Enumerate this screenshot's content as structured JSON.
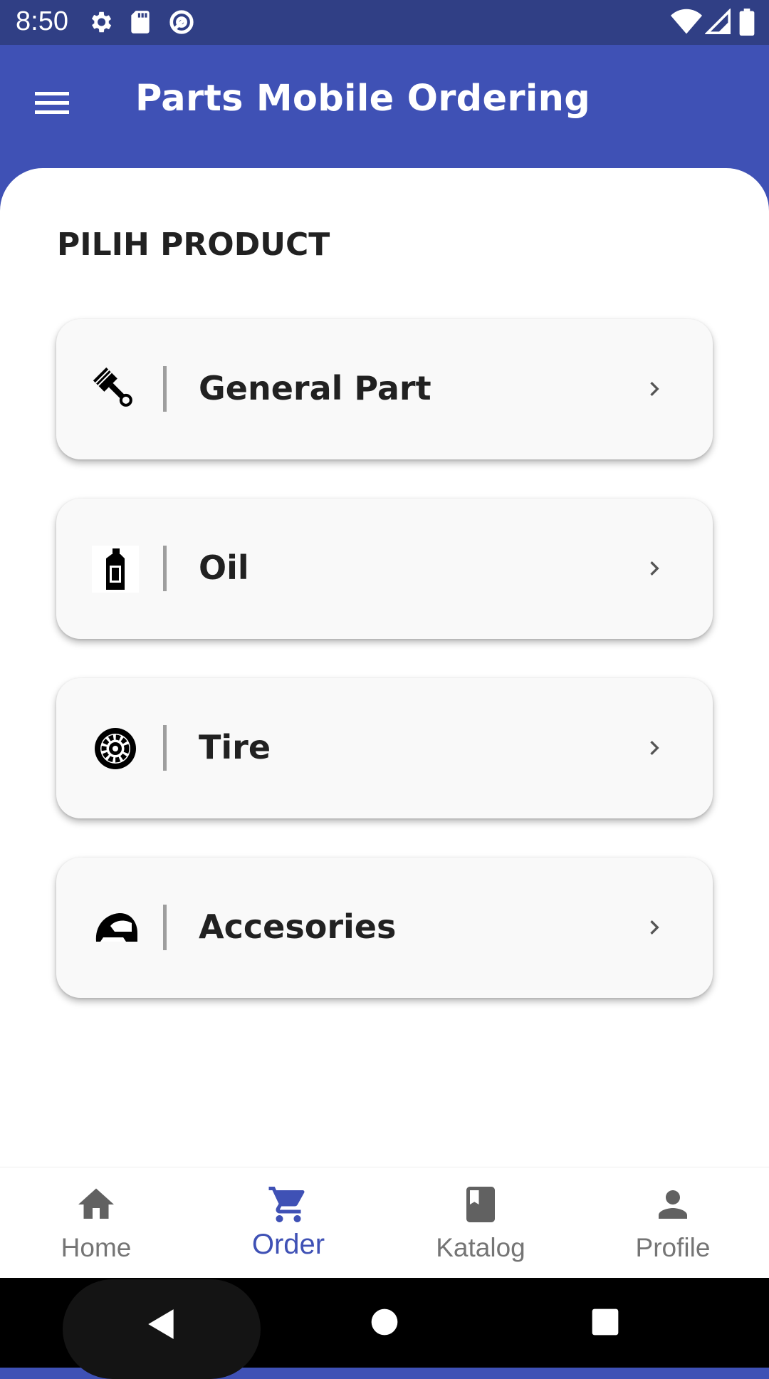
{
  "status_bar": {
    "time": "8:50",
    "icons": [
      "settings-icon",
      "sd-card-icon",
      "at-sign-icon",
      "wifi-icon",
      "signal-icon",
      "battery-icon"
    ]
  },
  "app_bar": {
    "title": "Parts Mobile Ordering",
    "menu_icon": "hamburger-menu-icon"
  },
  "section": {
    "title": "PILIH PRODUCT"
  },
  "products": [
    {
      "label": "General Part",
      "icon": "piston-icon"
    },
    {
      "label": "Oil",
      "icon": "oil-bottle-icon"
    },
    {
      "label": "Tire",
      "icon": "tire-icon"
    },
    {
      "label": "Accesories",
      "icon": "helmet-icon"
    }
  ],
  "bottom_nav": [
    {
      "label": "Home",
      "icon": "home-icon",
      "active": false
    },
    {
      "label": "Order",
      "icon": "cart-icon",
      "active": true
    },
    {
      "label": "Katalog",
      "icon": "book-icon",
      "active": false
    },
    {
      "label": "Profile",
      "icon": "person-icon",
      "active": false
    }
  ],
  "colors": {
    "primary": "#3f51b5",
    "status_bar": "#303f85",
    "active_nav": "#3f51b5",
    "inactive_nav": "#757575"
  }
}
